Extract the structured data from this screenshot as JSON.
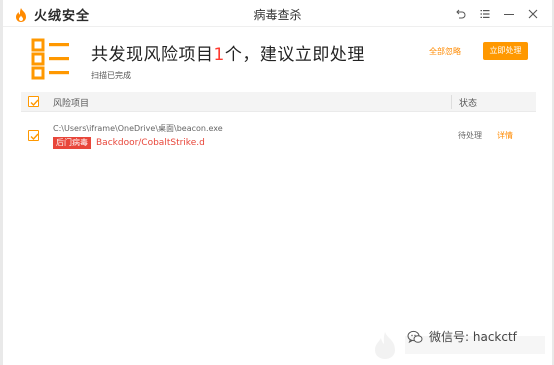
{
  "app": {
    "brand_name": "火绒安全",
    "window_title": "病毒查杀"
  },
  "window_controls": {
    "icons": [
      "back-icon",
      "menu-icon",
      "minimize-icon",
      "close-icon"
    ]
  },
  "header": {
    "headline_prefix": "共发现风险项目",
    "headline_count": "1",
    "headline_suffix": "个，建议立即处理",
    "subtext": "扫描已完成",
    "ignore_all_label": "全部忽略",
    "handle_now_label": "立即处理"
  },
  "table": {
    "columns": [
      "风险项目",
      "状态"
    ],
    "all_checked": true,
    "rows": [
      {
        "checked": true,
        "path": "C:\\Users\\iframe\\OneDrive\\桌面\\beacon.exe",
        "tag": "后门病毒",
        "threat": "Backdoor/CobaltStrike.d",
        "status": "待处理",
        "detail_label": "详情"
      }
    ]
  },
  "watermark": {
    "text": "微信号: hackctf"
  },
  "colors": {
    "accent": "#ff9800",
    "danger": "#e8463a",
    "count_red": "#ff3b30"
  }
}
